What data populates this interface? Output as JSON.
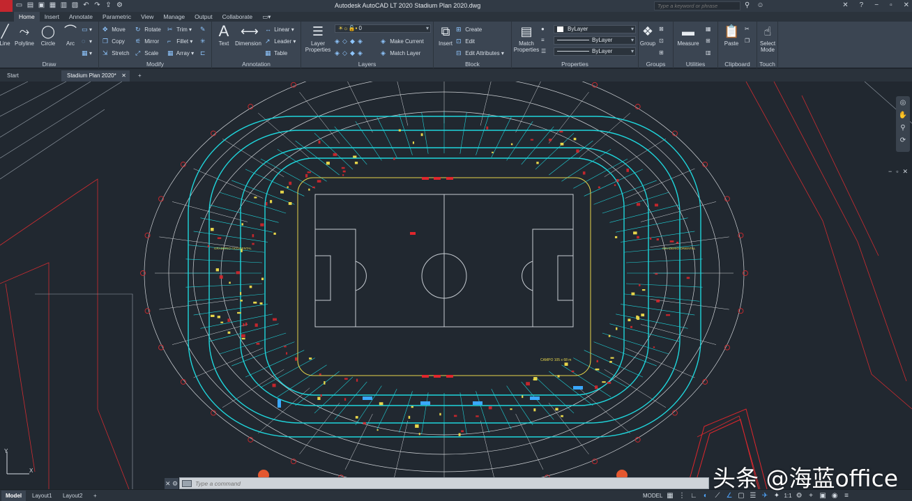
{
  "app": {
    "logo_text": "A",
    "title": "Autodesk AutoCAD LT 2020    Stadium Plan 2020.dwg",
    "search_placeholder": "Type a keyword or phrase"
  },
  "ribbon_tabs": [
    "Home",
    "Insert",
    "Annotate",
    "Parametric",
    "View",
    "Manage",
    "Output",
    "Collaborate"
  ],
  "ribbon": {
    "draw": {
      "title": "Draw",
      "line": "Line",
      "polyline": "Polyline",
      "circle": "Circle",
      "arc": "Arc"
    },
    "modify": {
      "title": "Modify",
      "move": "Move",
      "rotate": "Rotate",
      "trim": "Trim",
      "copy": "Copy",
      "mirror": "Mirror",
      "fillet": "Fillet",
      "stretch": "Stretch",
      "scale": "Scale",
      "array": "Array"
    },
    "annotation": {
      "title": "Annotation",
      "text": "Text",
      "dimension": "Dimension",
      "linear": "Linear",
      "leader": "Leader",
      "table": "Table"
    },
    "layers": {
      "title": "Layers",
      "layer_properties": "Layer Properties",
      "current_layer": "0",
      "make_current": "Make Current",
      "match_layer": "Match Layer"
    },
    "block": {
      "title": "Block",
      "insert": "Insert",
      "create": "Create",
      "edit": "Edit",
      "edit_attributes": "Edit Attributes"
    },
    "properties": {
      "title": "Properties",
      "match_properties": "Match Properties",
      "color": "ByLayer",
      "linetype": "ByLayer",
      "lineweight": "ByLayer"
    },
    "groups": {
      "title": "Groups",
      "group": "Group"
    },
    "utilities": {
      "title": "Utilities",
      "measure": "Measure"
    },
    "clipboard": {
      "title": "Clipboard",
      "paste": "Paste"
    },
    "touch": {
      "title": "Touch",
      "select_mode": "Select Mode"
    }
  },
  "file_tabs": {
    "start": "Start",
    "active": "Stadium Plan 2020*"
  },
  "drawing": {
    "field_label": "CAMPO 105 x 68 m",
    "left_stand_label": "GRADERIO\nOCCIDENTAL",
    "right_stand_label": "GRADERIO\nORIENTAL",
    "colors": {
      "background": "#212830",
      "field": "#c7ccd2",
      "stands": "#1fd6dc",
      "structure": "#d3d6da",
      "accent": "#e0262c",
      "annotation": "#e6d54a"
    }
  },
  "command_line": {
    "placeholder": "Type a command"
  },
  "status": {
    "layouts": [
      "Model",
      "Layout1",
      "Layout2"
    ],
    "model_label": "MODEL",
    "scale": "1:1"
  },
  "watermark": "头条 @海蓝office"
}
